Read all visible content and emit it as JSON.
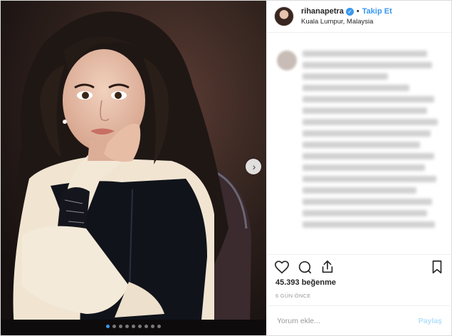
{
  "header": {
    "username": "rihanapetra",
    "follow_label": "Takip Et",
    "separator": "•",
    "location": "Kuala Lumpur, Malaysia"
  },
  "media": {
    "carousel_dots": 9,
    "active_dot": 0
  },
  "post": {
    "likes": "45.393 beğenme",
    "time_ago": "6 GÜN ÖNCE"
  },
  "comment_box": {
    "placeholder": "Yorum ekle...",
    "post_label": "Paylaş"
  },
  "colors": {
    "accent": "#3897f0",
    "post_disabled": "#b2dffc"
  },
  "icons": [
    "heart-icon",
    "comment-icon",
    "share-icon",
    "bookmark-icon",
    "verified-icon",
    "chevron-right-icon"
  ]
}
